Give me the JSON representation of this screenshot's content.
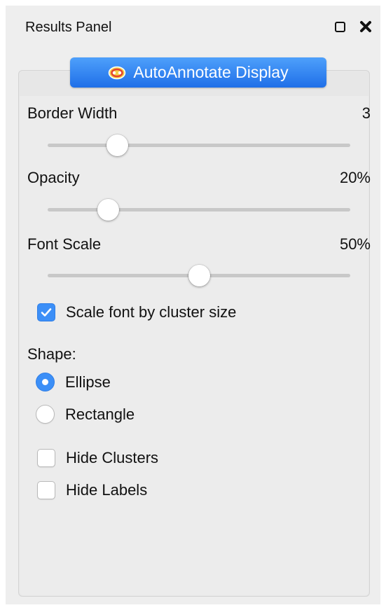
{
  "panel": {
    "title": "Results Panel"
  },
  "tab": {
    "label": "AutoAnnotate Display"
  },
  "controls": {
    "border_width": {
      "label": "Border Width",
      "value": "3",
      "fraction": 0.23
    },
    "opacity": {
      "label": "Opacity",
      "value": "20%",
      "fraction": 0.2
    },
    "font_scale": {
      "label": "Font Scale",
      "value": "50%",
      "fraction": 0.5
    }
  },
  "scale_font": {
    "label": "Scale font by cluster size",
    "checked": true
  },
  "shape": {
    "label": "Shape:",
    "options": [
      {
        "label": "Ellipse",
        "selected": true
      },
      {
        "label": "Rectangle",
        "selected": false
      }
    ]
  },
  "hide_clusters": {
    "label": "Hide Clusters",
    "checked": false
  },
  "hide_labels": {
    "label": "Hide Labels",
    "checked": false
  },
  "colors": {
    "accent": "#3c8ff7",
    "panel_bg": "#eeeeee"
  }
}
